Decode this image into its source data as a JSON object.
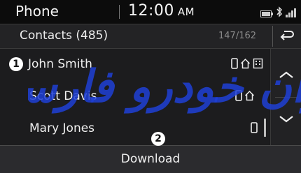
{
  "status_bar": {
    "app_title": "Phone",
    "time": "12:00",
    "ampm": "AM",
    "icons": [
      "battery-icon",
      "bluetooth-icon",
      "signal-icon"
    ]
  },
  "header": {
    "title": "Contacts (485)",
    "page_indicator": "147/162",
    "back_icon": "back-arrow-icon"
  },
  "contacts": [
    {
      "name": "John Smith",
      "icons": [
        "mobile-phone-icon",
        "home-icon",
        "office-icon"
      ]
    },
    {
      "name": "Scott Davis",
      "icons": [
        "mobile-phone-icon",
        "home-icon"
      ]
    },
    {
      "name": "Mary Jones",
      "icons": [
        "mobile-phone-icon"
      ]
    }
  ],
  "callouts": {
    "first": "1",
    "second": "2"
  },
  "download_label": "Download",
  "watermark_text": "ایران خودرو فارسی",
  "colors": {
    "background": "#1b1b1d",
    "watermark": "#1f3fd6",
    "text": "#f0f0f0"
  }
}
